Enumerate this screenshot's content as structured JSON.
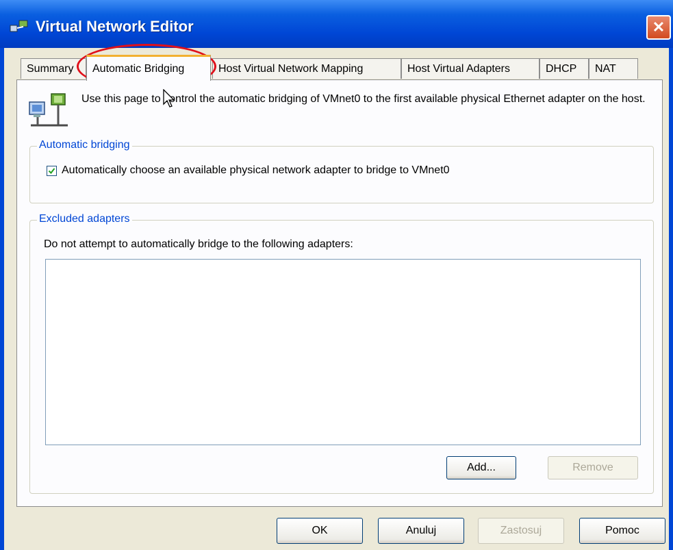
{
  "window": {
    "title": "Virtual Network Editor",
    "close_label": "✕"
  },
  "tabs": [
    {
      "label": "Summary",
      "active": false
    },
    {
      "label": "Automatic Bridging",
      "active": true
    },
    {
      "label": "Host Virtual Network Mapping",
      "active": false
    },
    {
      "label": "Host Virtual Adapters",
      "active": false
    },
    {
      "label": "DHCP",
      "active": false
    },
    {
      "label": "NAT",
      "active": false
    }
  ],
  "page": {
    "description": "Use this page to control the automatic bridging of VMnet0 to the first available physical Ethernet adapter on the host.",
    "automatic_bridging": {
      "title": "Automatic bridging",
      "checkbox_label": "Automatically choose an available physical network adapter to bridge to VMnet0",
      "checked": true
    },
    "excluded": {
      "title": "Excluded adapters",
      "hint": "Do not attempt to automatically bridge to the following adapters:",
      "adapters": [],
      "add_label": "Add...",
      "remove_label": "Remove"
    }
  },
  "footer": {
    "ok_label": "OK",
    "cancel_label": "Anuluj",
    "apply_label": "Zastosuj",
    "help_label": "Pomoc"
  },
  "colors": {
    "titlebar": "#0046d5",
    "group_title": "#0046d5",
    "annotation": "#e0101a"
  },
  "icons": [
    "network-app-icon",
    "close-icon",
    "network-computers-icon",
    "checkmark-icon",
    "mouse-cursor-icon"
  ]
}
